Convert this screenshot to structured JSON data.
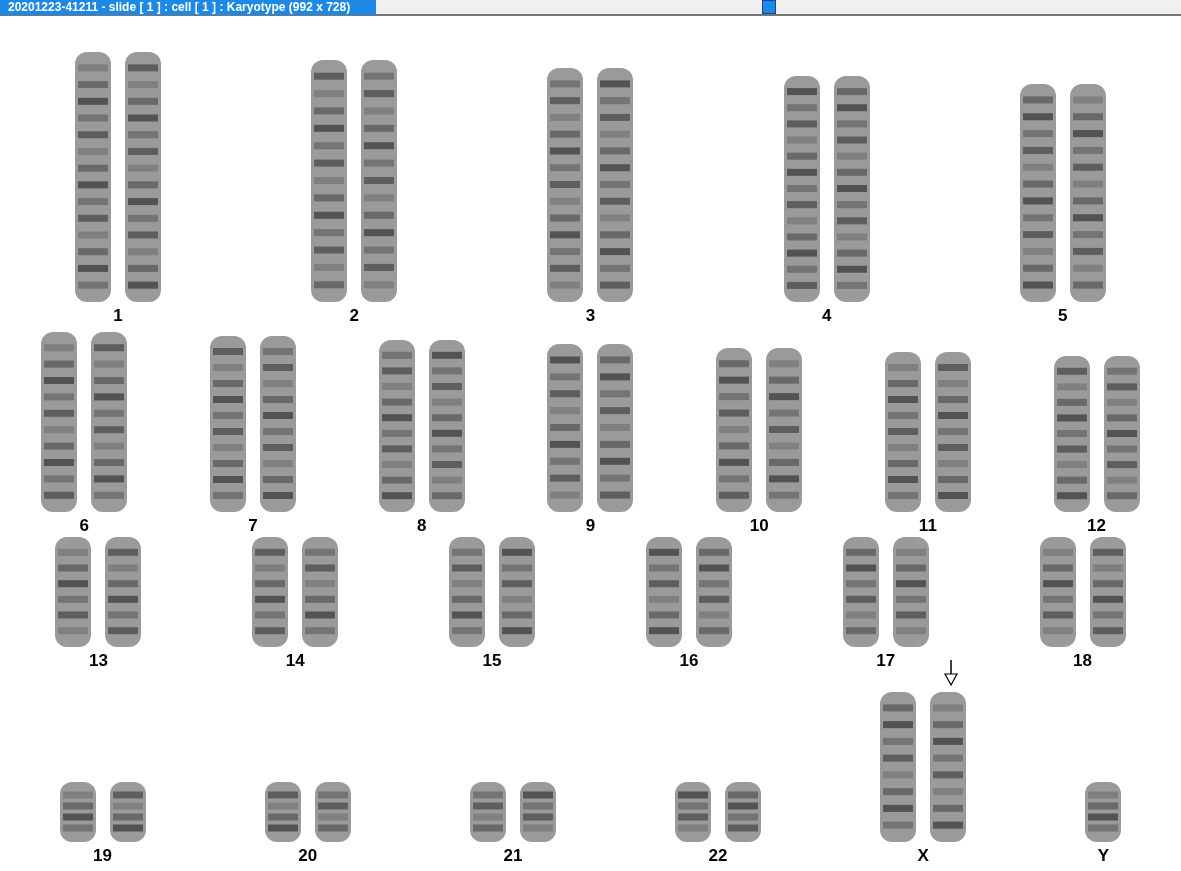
{
  "window": {
    "title": "20201223-41211 - slide [ 1 ] : cell [ 1 ] : Karyotype  (992 x 728)"
  },
  "rows": [
    {
      "items": [
        {
          "label": "1",
          "kind": "pair",
          "marked": false
        },
        {
          "label": "2",
          "kind": "pair",
          "marked": false
        },
        {
          "label": "3",
          "kind": "pair",
          "marked": false
        },
        {
          "label": "4",
          "kind": "pair",
          "marked": false
        },
        {
          "label": "5",
          "kind": "pair",
          "marked": false
        }
      ]
    },
    {
      "items": [
        {
          "label": "6",
          "kind": "pair",
          "marked": false
        },
        {
          "label": "7",
          "kind": "pair",
          "marked": false
        },
        {
          "label": "8",
          "kind": "pair",
          "marked": false
        },
        {
          "label": "9",
          "kind": "pair",
          "marked": false
        },
        {
          "label": "10",
          "kind": "pair",
          "marked": false
        },
        {
          "label": "11",
          "kind": "pair",
          "marked": false
        },
        {
          "label": "12",
          "kind": "pair",
          "marked": false
        }
      ]
    },
    {
      "items": [
        {
          "label": "13",
          "kind": "pair",
          "marked": false
        },
        {
          "label": "14",
          "kind": "pair",
          "marked": false
        },
        {
          "label": "15",
          "kind": "pair",
          "marked": false
        },
        {
          "label": "16",
          "kind": "pair",
          "marked": false
        },
        {
          "label": "17",
          "kind": "pair",
          "marked": false
        },
        {
          "label": "18",
          "kind": "pair",
          "marked": false
        }
      ]
    },
    {
      "items": [
        {
          "label": "19",
          "kind": "pair",
          "marked": false
        },
        {
          "label": "20",
          "kind": "pair",
          "marked": false
        },
        {
          "label": "21",
          "kind": "pair",
          "marked": false
        },
        {
          "label": "22",
          "kind": "pair",
          "marked": false
        },
        {
          "label": "X",
          "kind": "pair",
          "marked": true
        },
        {
          "label": "Y",
          "kind": "single",
          "marked": false
        }
      ]
    }
  ]
}
